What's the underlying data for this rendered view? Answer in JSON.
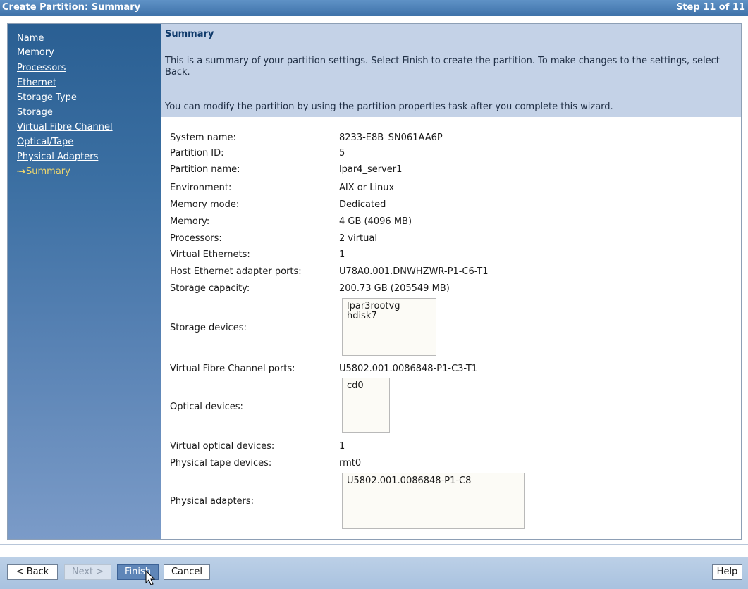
{
  "titlebar": {
    "title": "Create Partition: Summary",
    "step": "Step 11 of 11"
  },
  "nav": {
    "items": [
      {
        "label": "Name"
      },
      {
        "label": "Memory"
      },
      {
        "label": "Processors"
      },
      {
        "label": "Ethernet"
      },
      {
        "label": "Storage Type"
      },
      {
        "label": "Storage"
      },
      {
        "label": "Virtual Fibre Channel"
      },
      {
        "label": "Optical/Tape"
      },
      {
        "label": "Physical Adapters"
      },
      {
        "label": "Summary"
      }
    ],
    "current_marker": "··➔",
    "current_index": 9
  },
  "info": {
    "title": "Summary",
    "p1": "This is a summary of your partition settings. Select Finish to create the partition. To make changes to the settings, select Back.",
    "p2": "You can modify the partition by using the partition properties task after you complete this wizard."
  },
  "summary": {
    "system_name": {
      "label": "System name:",
      "value": "8233-E8B_SN061AA6P"
    },
    "partition_id": {
      "label": "Partition ID:",
      "value": "5"
    },
    "partition_name": {
      "label": "Partition name:",
      "value": "lpar4_server1"
    },
    "environment": {
      "label": "Environment:",
      "value": "AIX or Linux"
    },
    "memory_mode": {
      "label": "Memory mode:",
      "value": "Dedicated"
    },
    "memory": {
      "label": "Memory:",
      "value": "4 GB (4096 MB)"
    },
    "processors": {
      "label": "Processors:",
      "value": "2 virtual"
    },
    "virtual_ethernets": {
      "label": "Virtual Ethernets:",
      "value": "1"
    },
    "host_ethernet_ports": {
      "label": "Host Ethernet adapter ports:",
      "value": "U78A0.001.DNWHZWR-P1-C6-T1"
    },
    "storage_capacity": {
      "label": "Storage capacity:",
      "value": "200.73 GB (205549 MB)"
    },
    "storage_devices": {
      "label": "Storage devices:",
      "items": [
        "lpar3rootvg",
        "hdisk7"
      ]
    },
    "vfc_ports": {
      "label": "Virtual Fibre Channel ports:",
      "value": "U5802.001.0086848-P1-C3-T1"
    },
    "optical_devices": {
      "label": "Optical devices:",
      "items": [
        "cd0"
      ]
    },
    "virtual_optical": {
      "label": "Virtual optical devices:",
      "value": "1"
    },
    "physical_tape": {
      "label": "Physical tape devices:",
      "value": "rmt0"
    },
    "physical_adapters": {
      "label": "Physical adapters:",
      "items": [
        "U5802.001.0086848-P1-C8"
      ]
    }
  },
  "buttons": {
    "back": "< Back",
    "next": "Next >",
    "finish": "Finish",
    "cancel": "Cancel",
    "help": "Help"
  }
}
